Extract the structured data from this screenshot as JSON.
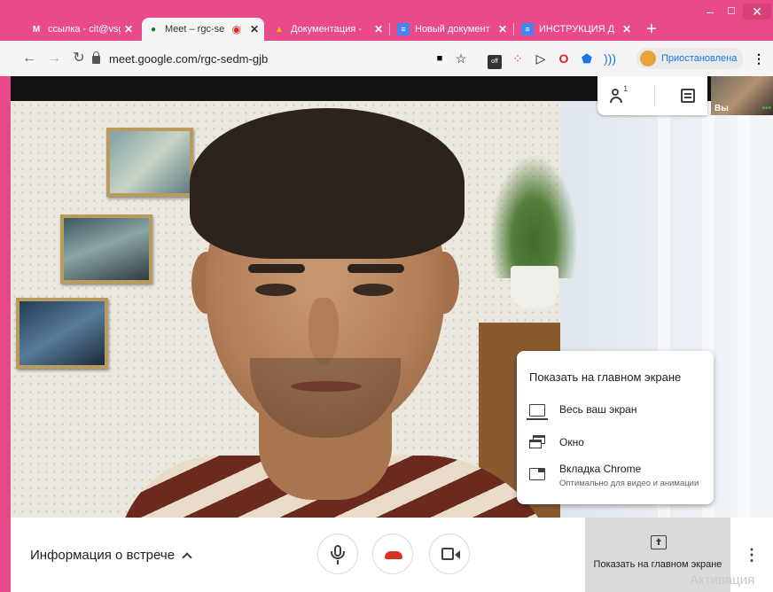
{
  "browser": {
    "tabs": [
      {
        "title": "ссылка - cit@vsg",
        "favicon": "gmail-icon",
        "active": false
      },
      {
        "title": "Meet – rgc-se",
        "favicon": "meet-icon",
        "active": true
      },
      {
        "title": "Документация -",
        "favicon": "drive-icon",
        "active": false
      },
      {
        "title": "Новый документ",
        "favicon": "docs-icon",
        "active": false
      },
      {
        "title": "ИНСТРУКЦИЯ Д",
        "favicon": "docs-icon",
        "active": false
      }
    ],
    "close_glyph": "✕",
    "new_tab_glyph": "+",
    "url": "meet.google.com/rgc-sedm-gjb",
    "profile_status": "Приостановлена",
    "extension_off_label": "off",
    "colors": {
      "theme": "#e94b8a",
      "toolbar": "#f5f5f5",
      "accent": "#1a73e8"
    }
  },
  "meet": {
    "participants_count": "1",
    "self_label": "Вы",
    "present_menu": {
      "title": "Показать на главном экране",
      "items": [
        {
          "label": "Весь ваш экран",
          "icon": "screen-icon"
        },
        {
          "label": "Окно",
          "icon": "window-icon"
        },
        {
          "label": "Вкладка Chrome",
          "sublabel": "Оптимально для видео и анимации",
          "icon": "chrome-tab-icon"
        }
      ]
    },
    "bottom": {
      "meeting_info": "Информация о встрече",
      "present_label": "Показать на главном экране",
      "watermark": "Активация"
    },
    "colors": {
      "hangup": "#d93025",
      "present_bg": "#dadada"
    }
  }
}
